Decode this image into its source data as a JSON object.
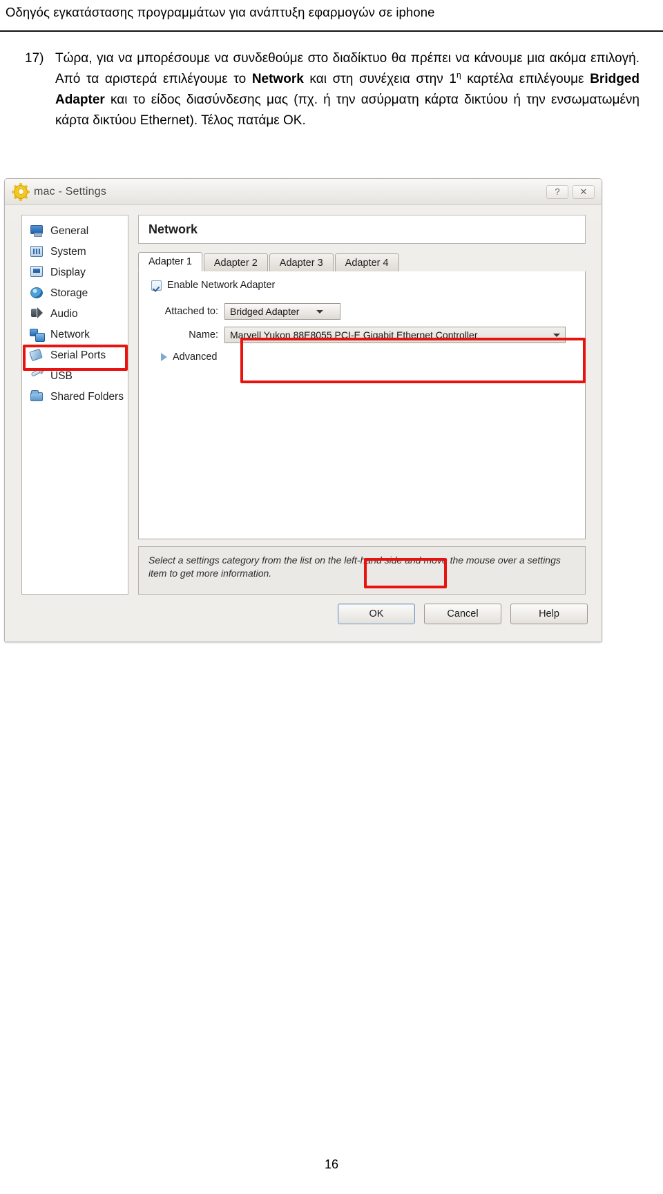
{
  "document": {
    "running_header": "Οδηγός εγκατάστασης προγραμμάτων για ανάπτυξη εφαρμογών σε iphone",
    "page_number": "16",
    "step": {
      "number": "17)",
      "text_part_1": "Τώρα, για να μπορέσουμε να συνδεθούμε στο διαδίκτυο θα πρέπει να κάνουμε μια ακόμα επιλογή. Από τα αριστερά επιλέγουμε το ",
      "bold_1": "Network",
      "text_part_2": " και στη συνέχεια στην 1",
      "superscript": "η",
      "text_part_3": " καρτέλα επιλέγουμε ",
      "bold_2": "Bridged Adapter",
      "text_part_4": " και το είδος διασύνδεσης μας (πχ. ή την ασύρματη κάρτα δικτύου ή την ενσωματωμένη κάρτα δικτύου Ethernet). Τέλος πατάμε ΟΚ."
    }
  },
  "screenshot": {
    "titlebar": {
      "icon": "gear-icon",
      "title": "mac - Settings",
      "help_button": "?",
      "close_button": "✕"
    },
    "categories": [
      {
        "label": "General",
        "icon": "monitor-icon",
        "selected": false
      },
      {
        "label": "System",
        "icon": "system-icon",
        "selected": false
      },
      {
        "label": "Display",
        "icon": "display-icon",
        "selected": false
      },
      {
        "label": "Storage",
        "icon": "storage-icon",
        "selected": false
      },
      {
        "label": "Audio",
        "icon": "audio-icon",
        "selected": false
      },
      {
        "label": "Network",
        "icon": "network-icon",
        "selected": true
      },
      {
        "label": "Serial Ports",
        "icon": "serial-icon",
        "selected": false
      },
      {
        "label": "USB",
        "icon": "usb-icon",
        "selected": false
      },
      {
        "label": "Shared Folders",
        "icon": "folder-icon",
        "selected": false
      }
    ],
    "pane": {
      "title": "Network",
      "tabs": [
        {
          "label": "Adapter 1",
          "active": true
        },
        {
          "label": "Adapter 2",
          "active": false
        },
        {
          "label": "Adapter 3",
          "active": false
        },
        {
          "label": "Adapter 4",
          "active": false
        }
      ],
      "enable_checkbox_label": "Enable Network Adapter",
      "enable_checkbox_checked": true,
      "attached_to_label": "Attached to:",
      "attached_to_value": "Bridged Adapter",
      "name_label": "Name:",
      "name_value": "Marvell Yukon 88E8055 PCI-E Gigabit Ethernet Controller",
      "advanced_label": "Advanced",
      "help_text": "Select a settings category from the list on the left-hand side and move the mouse over a settings item to get more information."
    },
    "buttons": {
      "ok": "OK",
      "cancel": "Cancel",
      "help": "Help"
    },
    "highlight_color": "#e8130f"
  }
}
